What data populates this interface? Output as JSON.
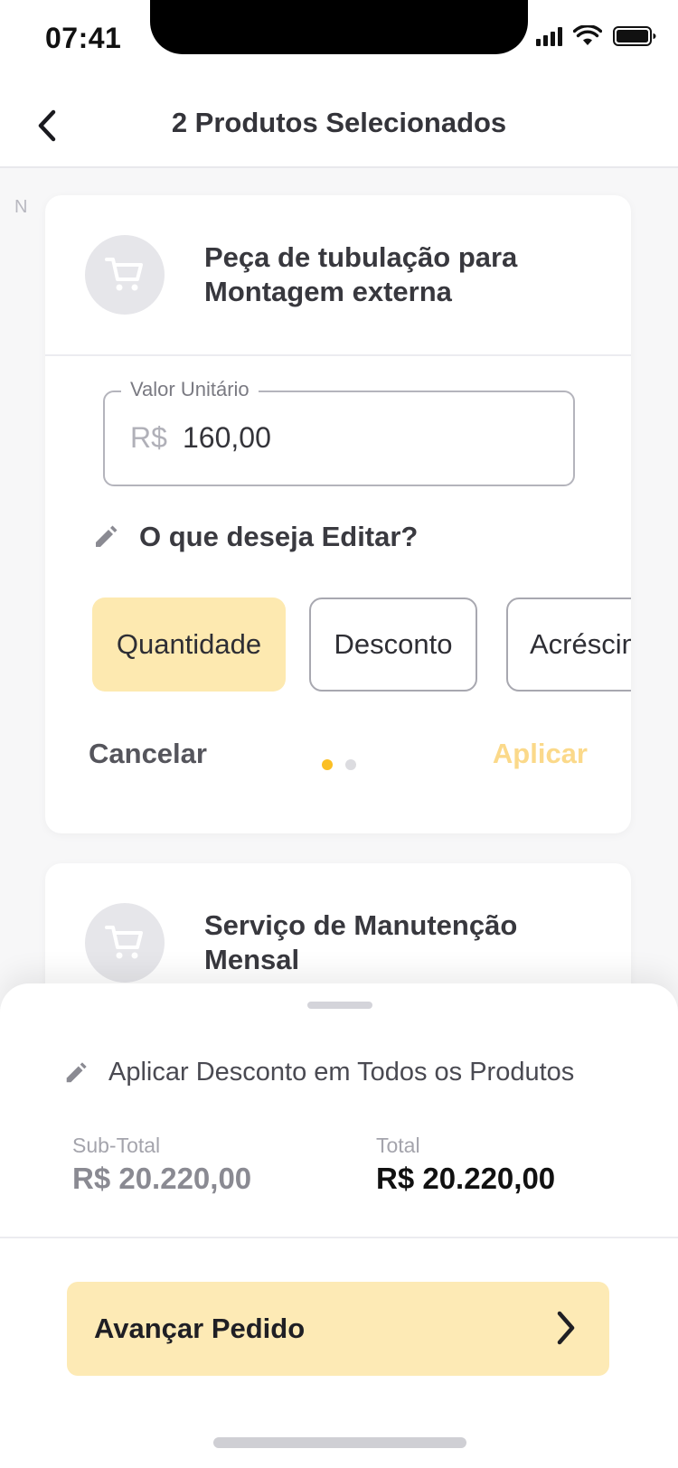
{
  "status_bar": {
    "time": "07:41"
  },
  "header": {
    "title": "2 Produtos Selecionados"
  },
  "side_letter": "N",
  "products": [
    {
      "name": "Peça de tubulação para Montagem externa",
      "unit_price": {
        "legend": "Valor Unitário",
        "prefix": "R$",
        "value": "160,00"
      },
      "edit_prompt": "O que deseja Editar?",
      "options": [
        {
          "label": "Quantidade",
          "selected": true
        },
        {
          "label": "Desconto",
          "selected": false
        },
        {
          "label": "Acréscimo",
          "selected": false
        }
      ],
      "cancel_label": "Cancelar",
      "apply_label": "Aplicar",
      "pager": {
        "total": 2,
        "active": 1
      }
    },
    {
      "name": "Serviço de Manutenção Mensal"
    }
  ],
  "sheet": {
    "discount_label": "Aplicar Desconto em Todos os Produtos",
    "subtotal_label": "Sub-Total",
    "subtotal_value": "R$ 20.220,00",
    "total_label": "Total",
    "total_value": "R$ 20.220,00",
    "advance_label": "Avançar Pedido"
  },
  "colors": {
    "accent": "#fbbf24",
    "accent_light": "#fde9b0",
    "apply_disabled": "#fbd98a",
    "subtotal": "#8a8a92",
    "total": "#111111"
  },
  "icons": {
    "back": "chevron-left-icon",
    "product": "shopping-cart-icon",
    "edit": "pencil-icon",
    "advance": "chevron-right-icon"
  }
}
